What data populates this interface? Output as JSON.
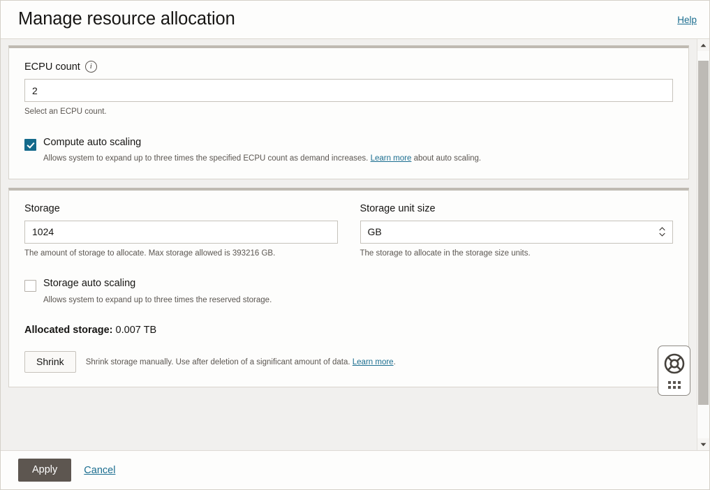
{
  "header": {
    "title": "Manage resource allocation",
    "help_label": "Help"
  },
  "compute_card": {
    "ecpu_label": "ECPU count",
    "ecpu_info_icon": "info-icon",
    "ecpu_value": "2",
    "ecpu_helper": "Select an ECPU count.",
    "auto_scaling_checked": true,
    "auto_scaling_label": "Compute auto scaling",
    "auto_scaling_desc_before": "Allows system to expand up to three times the specified ECPU count as demand increases.",
    "auto_scaling_link": "Learn more",
    "auto_scaling_desc_after": "about auto scaling."
  },
  "storage_card": {
    "storage_label": "Storage",
    "storage_value": "1024",
    "storage_helper": "The amount of storage to allocate. Max storage allowed is 393216 GB.",
    "unit_label": "Storage unit size",
    "unit_value": "GB",
    "unit_helper": "The storage to allocate in the storage size units.",
    "unit_spinner_icon": "spinner-up-down-icon",
    "storage_auto_scaling_checked": false,
    "storage_auto_scaling_label": "Storage auto scaling",
    "storage_auto_scaling_desc": "Allows system to expand up to three times the reserved storage.",
    "allocated_label": "Allocated storage:",
    "allocated_value": "0.007 TB",
    "shrink_button": "Shrink",
    "shrink_desc_before": "Shrink storage manually. Use after deletion of a significant amount of data.",
    "shrink_link": "Learn more",
    "shrink_desc_after": "."
  },
  "help_widget": {
    "icon": "life-ring-icon",
    "drag_handle_icon": "drag-dots-icon"
  },
  "scrollbar": {
    "up_icon": "scroll-up-arrow-icon",
    "down_icon": "scroll-down-arrow-icon"
  },
  "footer": {
    "apply_label": "Apply",
    "cancel_label": "Cancel"
  },
  "colors": {
    "accent_link": "#1a6d8f",
    "checkbox_checked": "#146a8b",
    "primary_button": "#5d5650",
    "card_top_border": "#bfbab2"
  }
}
